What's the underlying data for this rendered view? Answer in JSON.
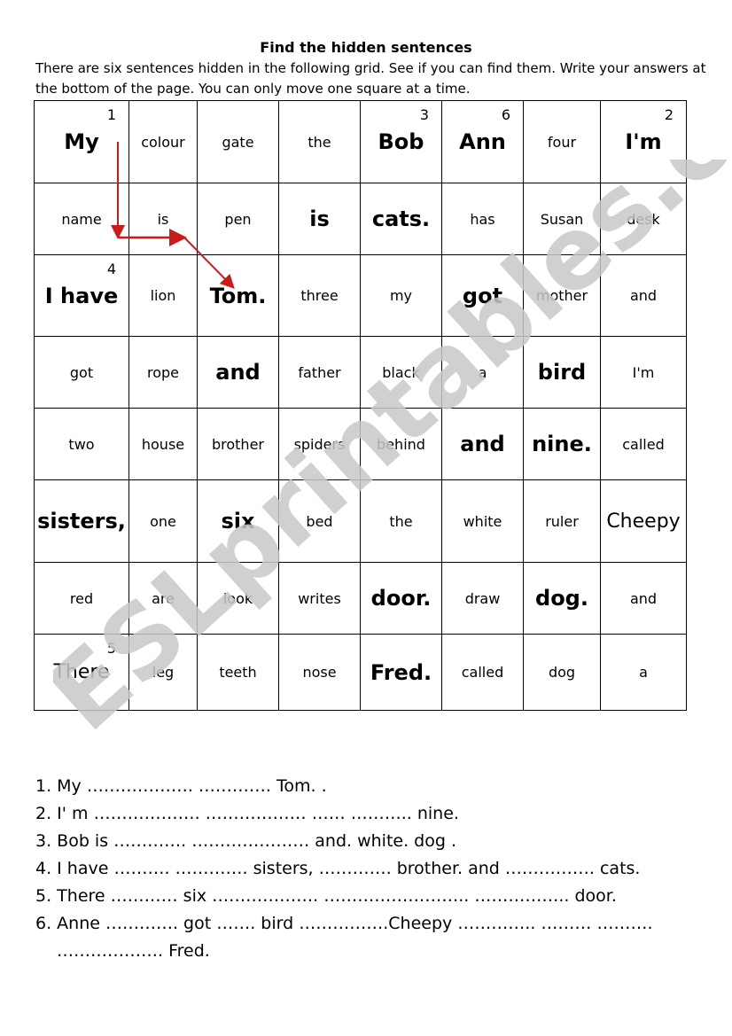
{
  "title": "Find the hidden sentences",
  "instructions": "There are six sentences hidden in the following grid. See if you can find them. Write your answers at the bottom of the page. You can only move one square at a time.",
  "watermark": "ESLprintables.com",
  "grid": [
    [
      {
        "w": "My",
        "n": "1",
        "s": "big"
      },
      {
        "w": "colour"
      },
      {
        "w": "gate"
      },
      {
        "w": "the"
      },
      {
        "w": "Bob",
        "n": "3",
        "s": "big"
      },
      {
        "w": "Ann",
        "n": "6",
        "s": "big"
      },
      {
        "w": "four"
      },
      {
        "w": "I'm",
        "n": "2",
        "s": "big"
      }
    ],
    [
      {
        "w": "name"
      },
      {
        "w": "is"
      },
      {
        "w": "pen"
      },
      {
        "w": "is",
        "s": "big"
      },
      {
        "w": "cats.",
        "s": "big"
      },
      {
        "w": "has"
      },
      {
        "w": "Susan"
      },
      {
        "w": "desk"
      }
    ],
    [
      {
        "w": "I have",
        "n": "4",
        "s": "big"
      },
      {
        "w": "lion"
      },
      {
        "w": "Tom.",
        "s": "big"
      },
      {
        "w": "three"
      },
      {
        "w": "my"
      },
      {
        "w": "got",
        "s": "big"
      },
      {
        "w": "mother"
      },
      {
        "w": "and"
      }
    ],
    [
      {
        "w": "got"
      },
      {
        "w": "rope"
      },
      {
        "w": "and",
        "s": "big"
      },
      {
        "w": "father"
      },
      {
        "w": "black"
      },
      {
        "w": "a"
      },
      {
        "w": "bird",
        "s": "big"
      },
      {
        "w": "I'm"
      }
    ],
    [
      {
        "w": "two"
      },
      {
        "w": "house"
      },
      {
        "w": "brother"
      },
      {
        "w": "spiders"
      },
      {
        "w": "behind"
      },
      {
        "w": "and",
        "s": "big"
      },
      {
        "w": "nine.",
        "s": "big"
      },
      {
        "w": "called"
      }
    ],
    [
      {
        "w": "sisters,",
        "s": "big"
      },
      {
        "w": "one"
      },
      {
        "w": "six",
        "s": "big"
      },
      {
        "w": "bed"
      },
      {
        "w": "the"
      },
      {
        "w": "white"
      },
      {
        "w": "ruler"
      },
      {
        "w": "Cheepy",
        "s": "med"
      }
    ],
    [
      {
        "w": "red"
      },
      {
        "w": "are"
      },
      {
        "w": "look"
      },
      {
        "w": "writes"
      },
      {
        "w": "door.",
        "s": "big"
      },
      {
        "w": "draw"
      },
      {
        "w": "dog.",
        "s": "big"
      },
      {
        "w": "and"
      }
    ],
    [
      {
        "w": "There",
        "n": "5",
        "s": "med"
      },
      {
        "w": "leg"
      },
      {
        "w": "teeth"
      },
      {
        "w": "nose"
      },
      {
        "w": "Fred.",
        "s": "big"
      },
      {
        "w": "called"
      },
      {
        "w": "dog"
      },
      {
        "w": "a"
      }
    ]
  ],
  "arrow_color": "#cc1a1a",
  "watermark_color": "#c8c8c8",
  "answers": [
    "1. My ……………….   ………….   Tom. .",
    "2. I' m ……………….   ………………   …… ………..   nine.",
    "3. Bob is ………….   …………………   and.   white.   dog .",
    "4. I have ……….   …………. sisters, ………….   brother.   and ……………. cats.",
    "5. There …………   six ……………….   ……………………..   …………….. door.",
    "6. Anne ………….   got   …….   bird   …………….Cheepy   …………..   ………   ……….",
    "………………. Fred."
  ]
}
